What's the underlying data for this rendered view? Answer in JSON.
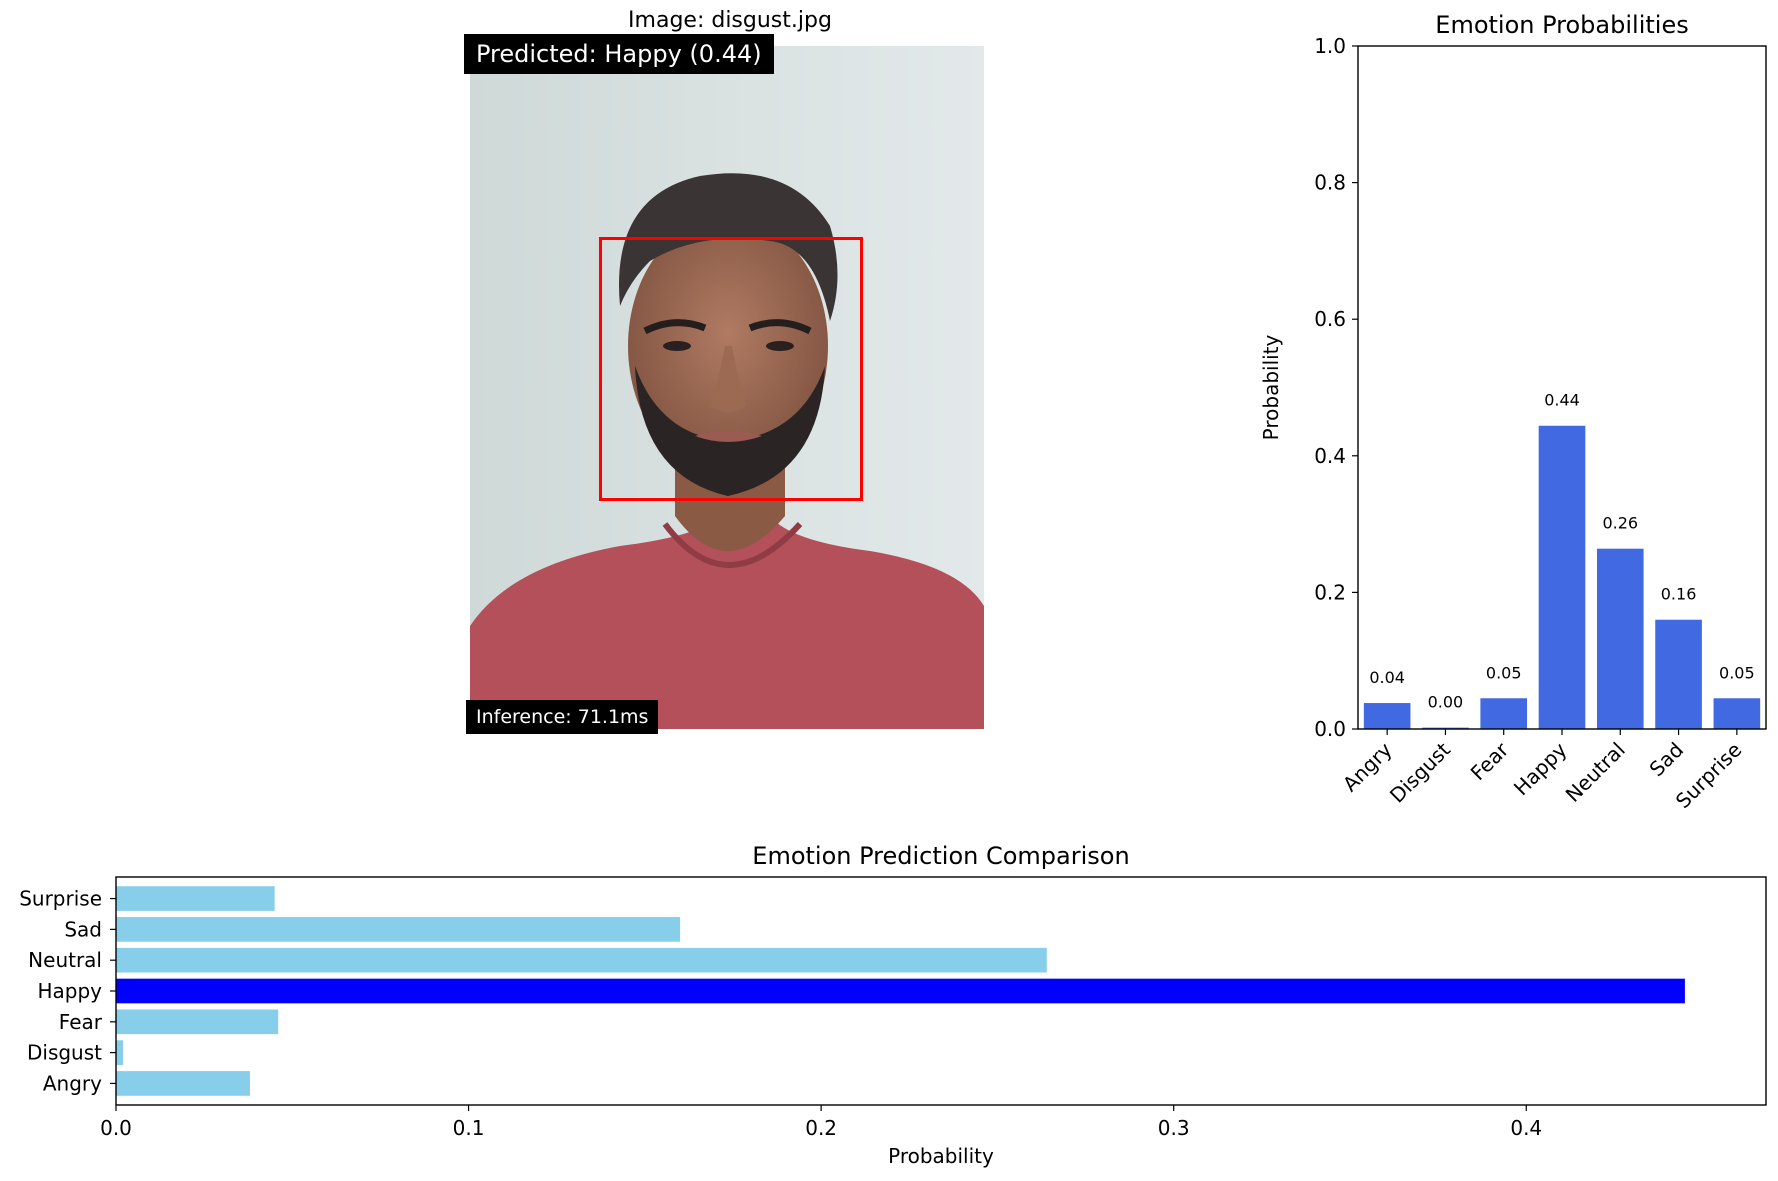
{
  "image_panel": {
    "title": "Image: disgust.jpg",
    "predicted_label": "Predicted: Happy (0.44)",
    "inference_label": "Inference: 71.1ms",
    "face_box_color": "#ff0000",
    "shirt_color": "#b3505a",
    "background_color": "#d9e1e0"
  },
  "chart_data": [
    {
      "type": "bar",
      "title": "Emotion Probabilities",
      "xlabel": "",
      "ylabel": "Probability",
      "categories": [
        "Angry",
        "Disgust",
        "Fear",
        "Happy",
        "Neutral",
        "Sad",
        "Surprise"
      ],
      "values": [
        0.038,
        0.002,
        0.045,
        0.444,
        0.264,
        0.16,
        0.045
      ],
      "value_labels": [
        "0.04",
        "0.00",
        "0.05",
        "0.44",
        "0.26",
        "0.16",
        "0.05"
      ],
      "ylim": [
        0,
        1.0
      ],
      "yticks": [
        "0.0",
        "0.2",
        "0.4",
        "0.6",
        "0.8",
        "1.0"
      ],
      "bar_color": "#4169e1",
      "grid": false
    },
    {
      "type": "bar",
      "orientation": "horizontal",
      "title": "Emotion Prediction Comparison",
      "xlabel": "Probability",
      "ylabel": "",
      "categories": [
        "Angry",
        "Disgust",
        "Fear",
        "Happy",
        "Neutral",
        "Sad",
        "Surprise"
      ],
      "values": [
        0.038,
        0.002,
        0.046,
        0.445,
        0.264,
        0.16,
        0.045
      ],
      "xlim": [
        0,
        0.468
      ],
      "xticks": [
        "0.0",
        "0.1",
        "0.2",
        "0.3",
        "0.4"
      ],
      "bar_color": "#87ceeb",
      "highlight_category": "Happy",
      "highlight_color": "#0000ff",
      "grid": false
    }
  ]
}
